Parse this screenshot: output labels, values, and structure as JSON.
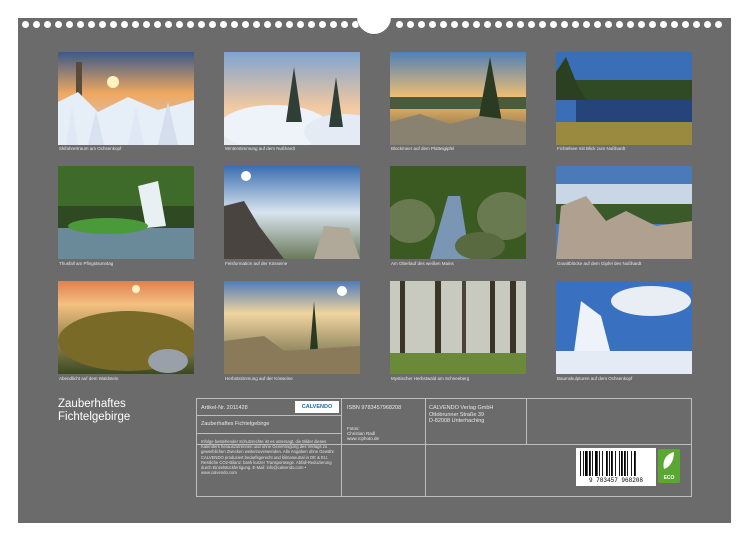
{
  "captions": [
    "Skifahrertraum am Ochsenkopf",
    "Winterstimmung auf dem Nußhardt",
    "Blockmeer auf dem Platteigipfel",
    "Fichtelsee mit Blick zum Nußhardt",
    "Thusfall am Pfingstsonntag",
    "Felsformation auf der Kösseine",
    "Am Oberlauf des weißen Mains",
    "Granitblöcke auf dem Gipfel des Nußhardt",
    "Abendlicht auf dem Waldstein",
    "Herbststimmung auf der Kösseine",
    "Mystischer Herbstwald am Schneeberg",
    "Baumskulpturen auf dem Ochsenkopf"
  ],
  "cover_title_line1": "Zauberhaftes",
  "cover_title_line2": "Fichtelgebirge",
  "article_no": "Artikel-Nr. 2011428",
  "calendar_title": "Zauberhaftes Fichtelgebirge",
  "logo_text": "CALVENDO",
  "isbn": "ISBN 9783457968208",
  "publisher": {
    "name": "CALVENDO Verlag GmbH",
    "street": "Ottobrunner Straße 39",
    "city": "D-82008 Unterhaching"
  },
  "photo_credit": {
    "label": "Fotos:",
    "name": "Christian Radl",
    "web": "www.rcphoto.de"
  },
  "legal_text": "Infolge bestehender Schutzrechte ist es untersagt, die Bilder dieses Kalenders herauszutrennen und ohne Genehmigung des Verlags zu gewerblichen Zwecken weiterzuverwenden. Alle Angaben ohne Gewähr. CALVENDO produziert bedarfsgerecht und klimaneutral in DE & EU. Restliche CO2-Bilanz: bank kurzer Transportwege. Abfall-Reduzierung durch Einzelstückfertigung. E-Mail: info@calvendo.com • www.calvendo.com",
  "barcode_number": "9 783457 968208",
  "eco_label": "ECO"
}
